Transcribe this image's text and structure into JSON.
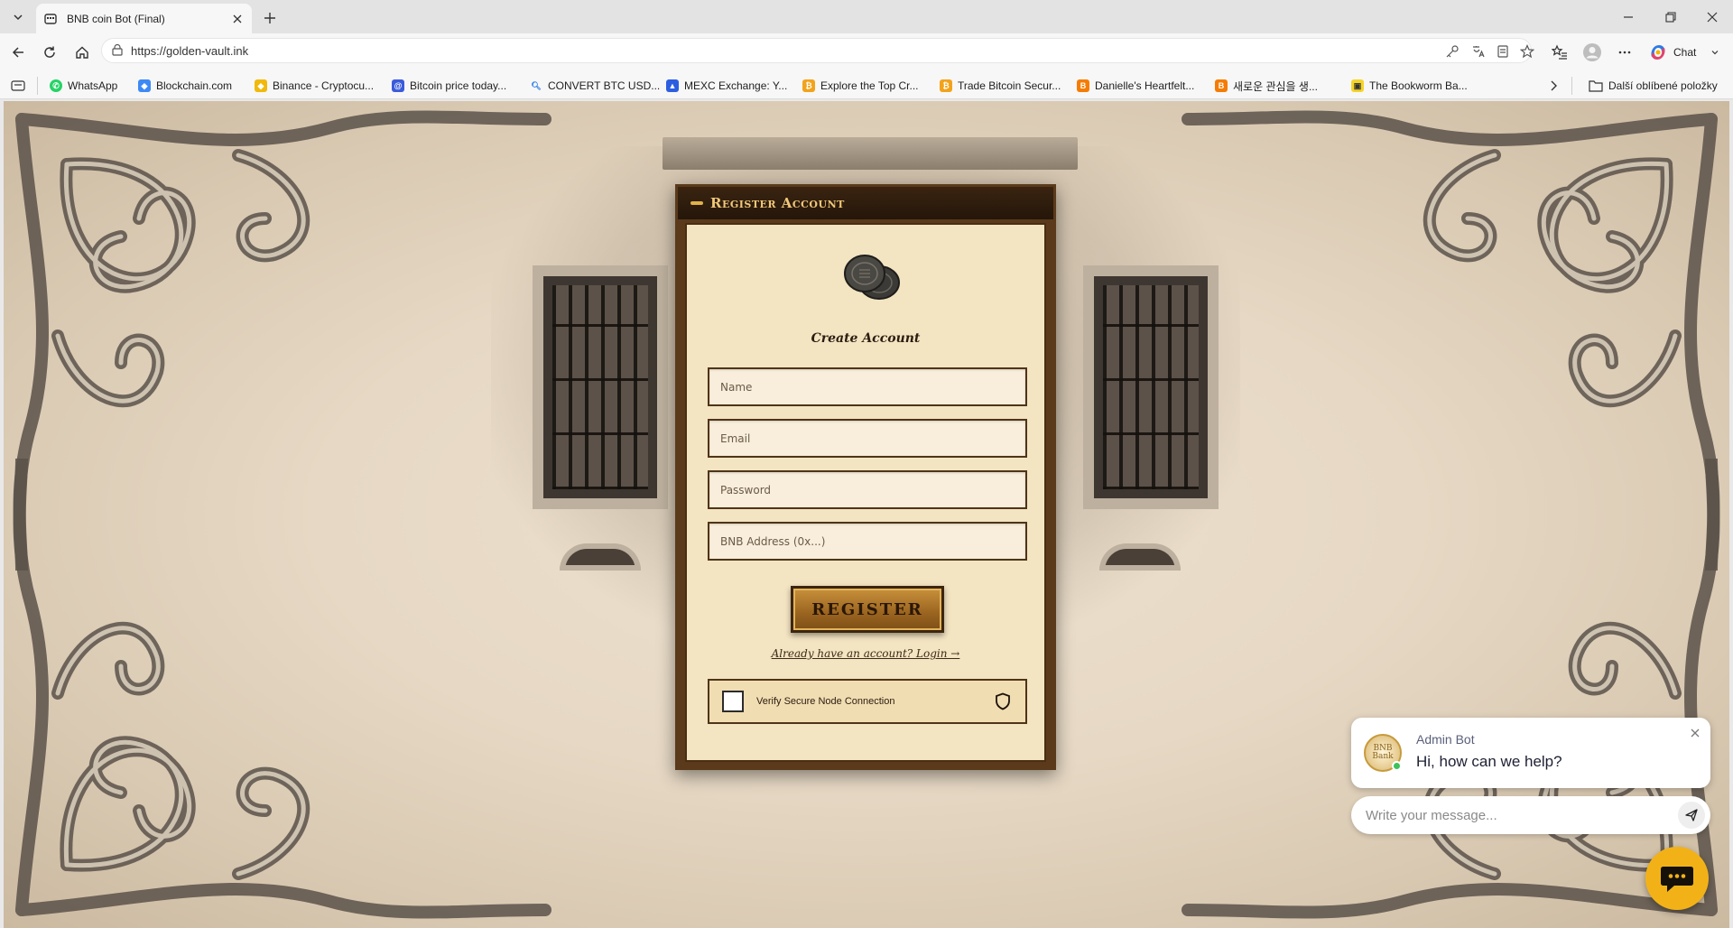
{
  "browser": {
    "tab_title": "BNB coin Bot (Final)",
    "url": "https://golden-vault.ink",
    "chat_label": "Chat",
    "bookmarks": [
      {
        "label": "WhatsApp",
        "color": "#25d366"
      },
      {
        "label": "Blockchain.com",
        "color": "#3d89f5"
      },
      {
        "label": "Binance - Cryptocu...",
        "color": "#f0b90b"
      },
      {
        "label": "Bitcoin price today...",
        "color": "#3b5bdb"
      },
      {
        "label": "CONVERT BTC USD...",
        "color": "#1a73e8"
      },
      {
        "label": "MEXC Exchange: Y...",
        "color": "#2c5fe0"
      },
      {
        "label": "Explore the Top Cr...",
        "color": "#f2a31b"
      },
      {
        "label": "Trade Bitcoin Secur...",
        "color": "#f2a31b"
      },
      {
        "label": "Danielle's Heartfelt...",
        "color": "#f57c00"
      },
      {
        "label": "새로운 관심을 생...",
        "color": "#f57c00"
      },
      {
        "label": "The Bookworm Ba...",
        "color": "#f5d42a"
      }
    ],
    "other_bookmarks": "Další oblíbené položky"
  },
  "register": {
    "header": "Register Account",
    "subtitle": "Create Account",
    "name_placeholder": "Name",
    "email_placeholder": "Email",
    "password_placeholder": "Password",
    "address_placeholder": "BNB Address (0x...)",
    "submit_label": "REGISTER",
    "login_link": "Already have an account? Login →",
    "verify_label": "Verify Secure Node Connection"
  },
  "chat": {
    "avatar_text": "BNB Bank",
    "bot_name": "Admin Bot",
    "greeting": "Hi, how can we help?",
    "input_placeholder": "Write your message..."
  },
  "colors": {
    "accent_gold": "#f2b217",
    "card_header": "#24160a",
    "online": "#3cc25a"
  }
}
